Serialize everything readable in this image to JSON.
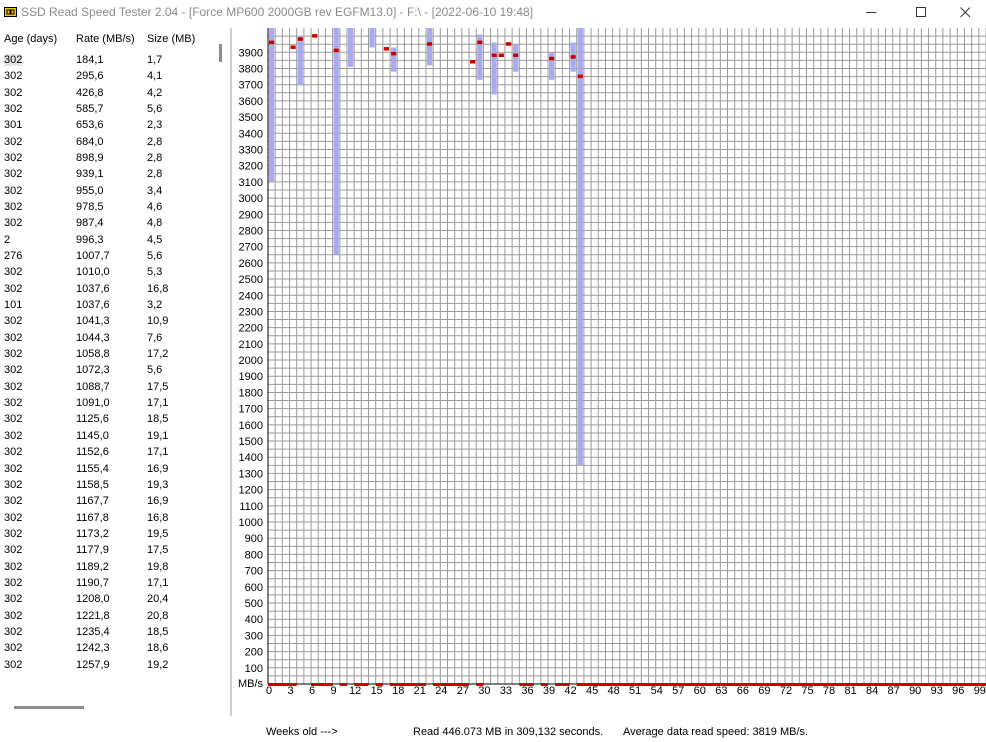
{
  "window": {
    "title": "SSD Read Speed Tester 2.04 - [Force MP600 2000GB rev EGFM13.0] - F:\\ - [2022-06-10 19:48]",
    "icon": "ssd-app-icon",
    "controls": [
      "minimize-icon",
      "maximize-icon",
      "close-icon"
    ]
  },
  "table": {
    "columns": [
      "Age (days)",
      "Rate (MB/s)",
      "Size (MB)"
    ],
    "rows": [
      [
        "302",
        "184,1",
        "1,7"
      ],
      [
        "302",
        "295,6",
        "4,1"
      ],
      [
        "302",
        "426,8",
        "4,2"
      ],
      [
        "302",
        "585,7",
        "5,6"
      ],
      [
        "301",
        "653,6",
        "2,3"
      ],
      [
        "302",
        "684,0",
        "2,8"
      ],
      [
        "302",
        "898,9",
        "2,8"
      ],
      [
        "302",
        "939,1",
        "2,8"
      ],
      [
        "302",
        "955,0",
        "3,4"
      ],
      [
        "302",
        "978,5",
        "4,6"
      ],
      [
        "302",
        "987,4",
        "4,8"
      ],
      [
        "2",
        "996,3",
        "4,5"
      ],
      [
        "276",
        "1007,7",
        "5,6"
      ],
      [
        "302",
        "1010,0",
        "5,3"
      ],
      [
        "302",
        "1037,6",
        "16,8"
      ],
      [
        "101",
        "1037,6",
        "3,2"
      ],
      [
        "302",
        "1041,3",
        "10,9"
      ],
      [
        "302",
        "1044,3",
        "7,6"
      ],
      [
        "302",
        "1058,8",
        "17,2"
      ],
      [
        "302",
        "1072,3",
        "5,6"
      ],
      [
        "302",
        "1088,7",
        "17,5"
      ],
      [
        "302",
        "1091,0",
        "17,1"
      ],
      [
        "302",
        "1125,6",
        "18,5"
      ],
      [
        "302",
        "1145,0",
        "19,1"
      ],
      [
        "302",
        "1152,6",
        "17,1"
      ],
      [
        "302",
        "1155,4",
        "16,9"
      ],
      [
        "302",
        "1158,5",
        "19,3"
      ],
      [
        "302",
        "1167,7",
        "16,9"
      ],
      [
        "302",
        "1167,8",
        "16,8"
      ],
      [
        "302",
        "1173,2",
        "19,5"
      ],
      [
        "302",
        "1177,9",
        "17,5"
      ],
      [
        "302",
        "1189,2",
        "19,8"
      ],
      [
        "302",
        "1190,7",
        "17,1"
      ],
      [
        "302",
        "1208,0",
        "20,4"
      ],
      [
        "302",
        "1221,8",
        "20,8"
      ],
      [
        "302",
        "1235,4",
        "18,5"
      ],
      [
        "302",
        "1242,3",
        "18,6"
      ],
      [
        "302",
        "1257,9",
        "19,2"
      ]
    ],
    "selected_row": 0
  },
  "chart_data": {
    "type": "bar",
    "y_unit_label": "MB/s",
    "x_axis_label": "Weeks old --->",
    "y_ticks": [
      100,
      200,
      300,
      400,
      500,
      600,
      700,
      800,
      900,
      1000,
      1100,
      1200,
      1300,
      1400,
      1500,
      1600,
      1700,
      1800,
      1900,
      2000,
      2100,
      2200,
      2300,
      2400,
      2500,
      2600,
      2700,
      2800,
      2900,
      3000,
      3100,
      3200,
      3300,
      3400,
      3500,
      3600,
      3700,
      3800,
      3900
    ],
    "x_ticks": [
      0,
      3,
      6,
      9,
      12,
      15,
      18,
      21,
      24,
      27,
      30,
      33,
      36,
      39,
      42,
      45,
      48,
      51,
      54,
      57,
      60,
      63,
      66,
      69,
      72,
      75,
      78,
      81,
      84,
      87,
      90,
      93,
      96,
      99
    ],
    "ylim": [
      0,
      4050
    ],
    "xlim": [
      0,
      100
    ],
    "range_series": [
      {
        "week": 0,
        "min": 3100,
        "max": 4050
      },
      {
        "week": 4,
        "min": 3700,
        "max": 4000
      },
      {
        "week": 9,
        "min": 2650,
        "max": 4050
      },
      {
        "week": 11,
        "min": 3810,
        "max": 4050
      },
      {
        "week": 14,
        "min": 3930,
        "max": 4050
      },
      {
        "week": 17,
        "min": 3780,
        "max": 3930
      },
      {
        "week": 22,
        "min": 3820,
        "max": 4050
      },
      {
        "week": 29,
        "min": 3730,
        "max": 4010
      },
      {
        "week": 31,
        "min": 3640,
        "max": 3960
      },
      {
        "week": 34,
        "min": 3780,
        "max": 3950
      },
      {
        "week": 39,
        "min": 3730,
        "max": 3900
      },
      {
        "week": 42,
        "min": 3780,
        "max": 3960
      },
      {
        "week": 43,
        "min": 1350,
        "max": 4050
      }
    ],
    "average_series": [
      {
        "week": 0,
        "value": 3960
      },
      {
        "week": 3,
        "value": 3930
      },
      {
        "week": 4,
        "value": 3980
      },
      {
        "week": 6,
        "value": 4000
      },
      {
        "week": 9,
        "value": 3910
      },
      {
        "week": 16,
        "value": 3920
      },
      {
        "week": 17,
        "value": 3890
      },
      {
        "week": 22,
        "value": 3950
      },
      {
        "week": 28,
        "value": 3840
      },
      {
        "week": 29,
        "value": 3960
      },
      {
        "week": 31,
        "value": 3880
      },
      {
        "week": 32,
        "value": 3880
      },
      {
        "week": 33,
        "value": 3950
      },
      {
        "week": 34,
        "value": 3880
      },
      {
        "week": 39,
        "value": 3860
      },
      {
        "week": 42,
        "value": 3870
      },
      {
        "week": 43,
        "value": 3750
      }
    ],
    "baseline_weeks": [
      0,
      1,
      2,
      3,
      6,
      7,
      8,
      10,
      12,
      13,
      15,
      17,
      18,
      19,
      20,
      21,
      23,
      24,
      25,
      26,
      27,
      29,
      35,
      36,
      38,
      40,
      41,
      43,
      44,
      45,
      46,
      47,
      48,
      49,
      50,
      51,
      52,
      53,
      54,
      55,
      56,
      57,
      58,
      59,
      60,
      61,
      62,
      63,
      64,
      65,
      66,
      67,
      68,
      69,
      70,
      71,
      72,
      73,
      74,
      75,
      76,
      77,
      78,
      79,
      80,
      81,
      82,
      83,
      84,
      85,
      86,
      87,
      88,
      89,
      90,
      91,
      92,
      93,
      94,
      95,
      96,
      97,
      98,
      99
    ],
    "colors": {
      "range": "#aaaaee",
      "average": "#cc0000",
      "grid": "#9a9a9a",
      "frame": "#000000"
    }
  },
  "footer": {
    "axis_label": "Weeks old --->",
    "read_summary": "Read 446.073 MB in 309,132 seconds.",
    "average_speed": "Average data read speed: 3819 MB/s."
  }
}
